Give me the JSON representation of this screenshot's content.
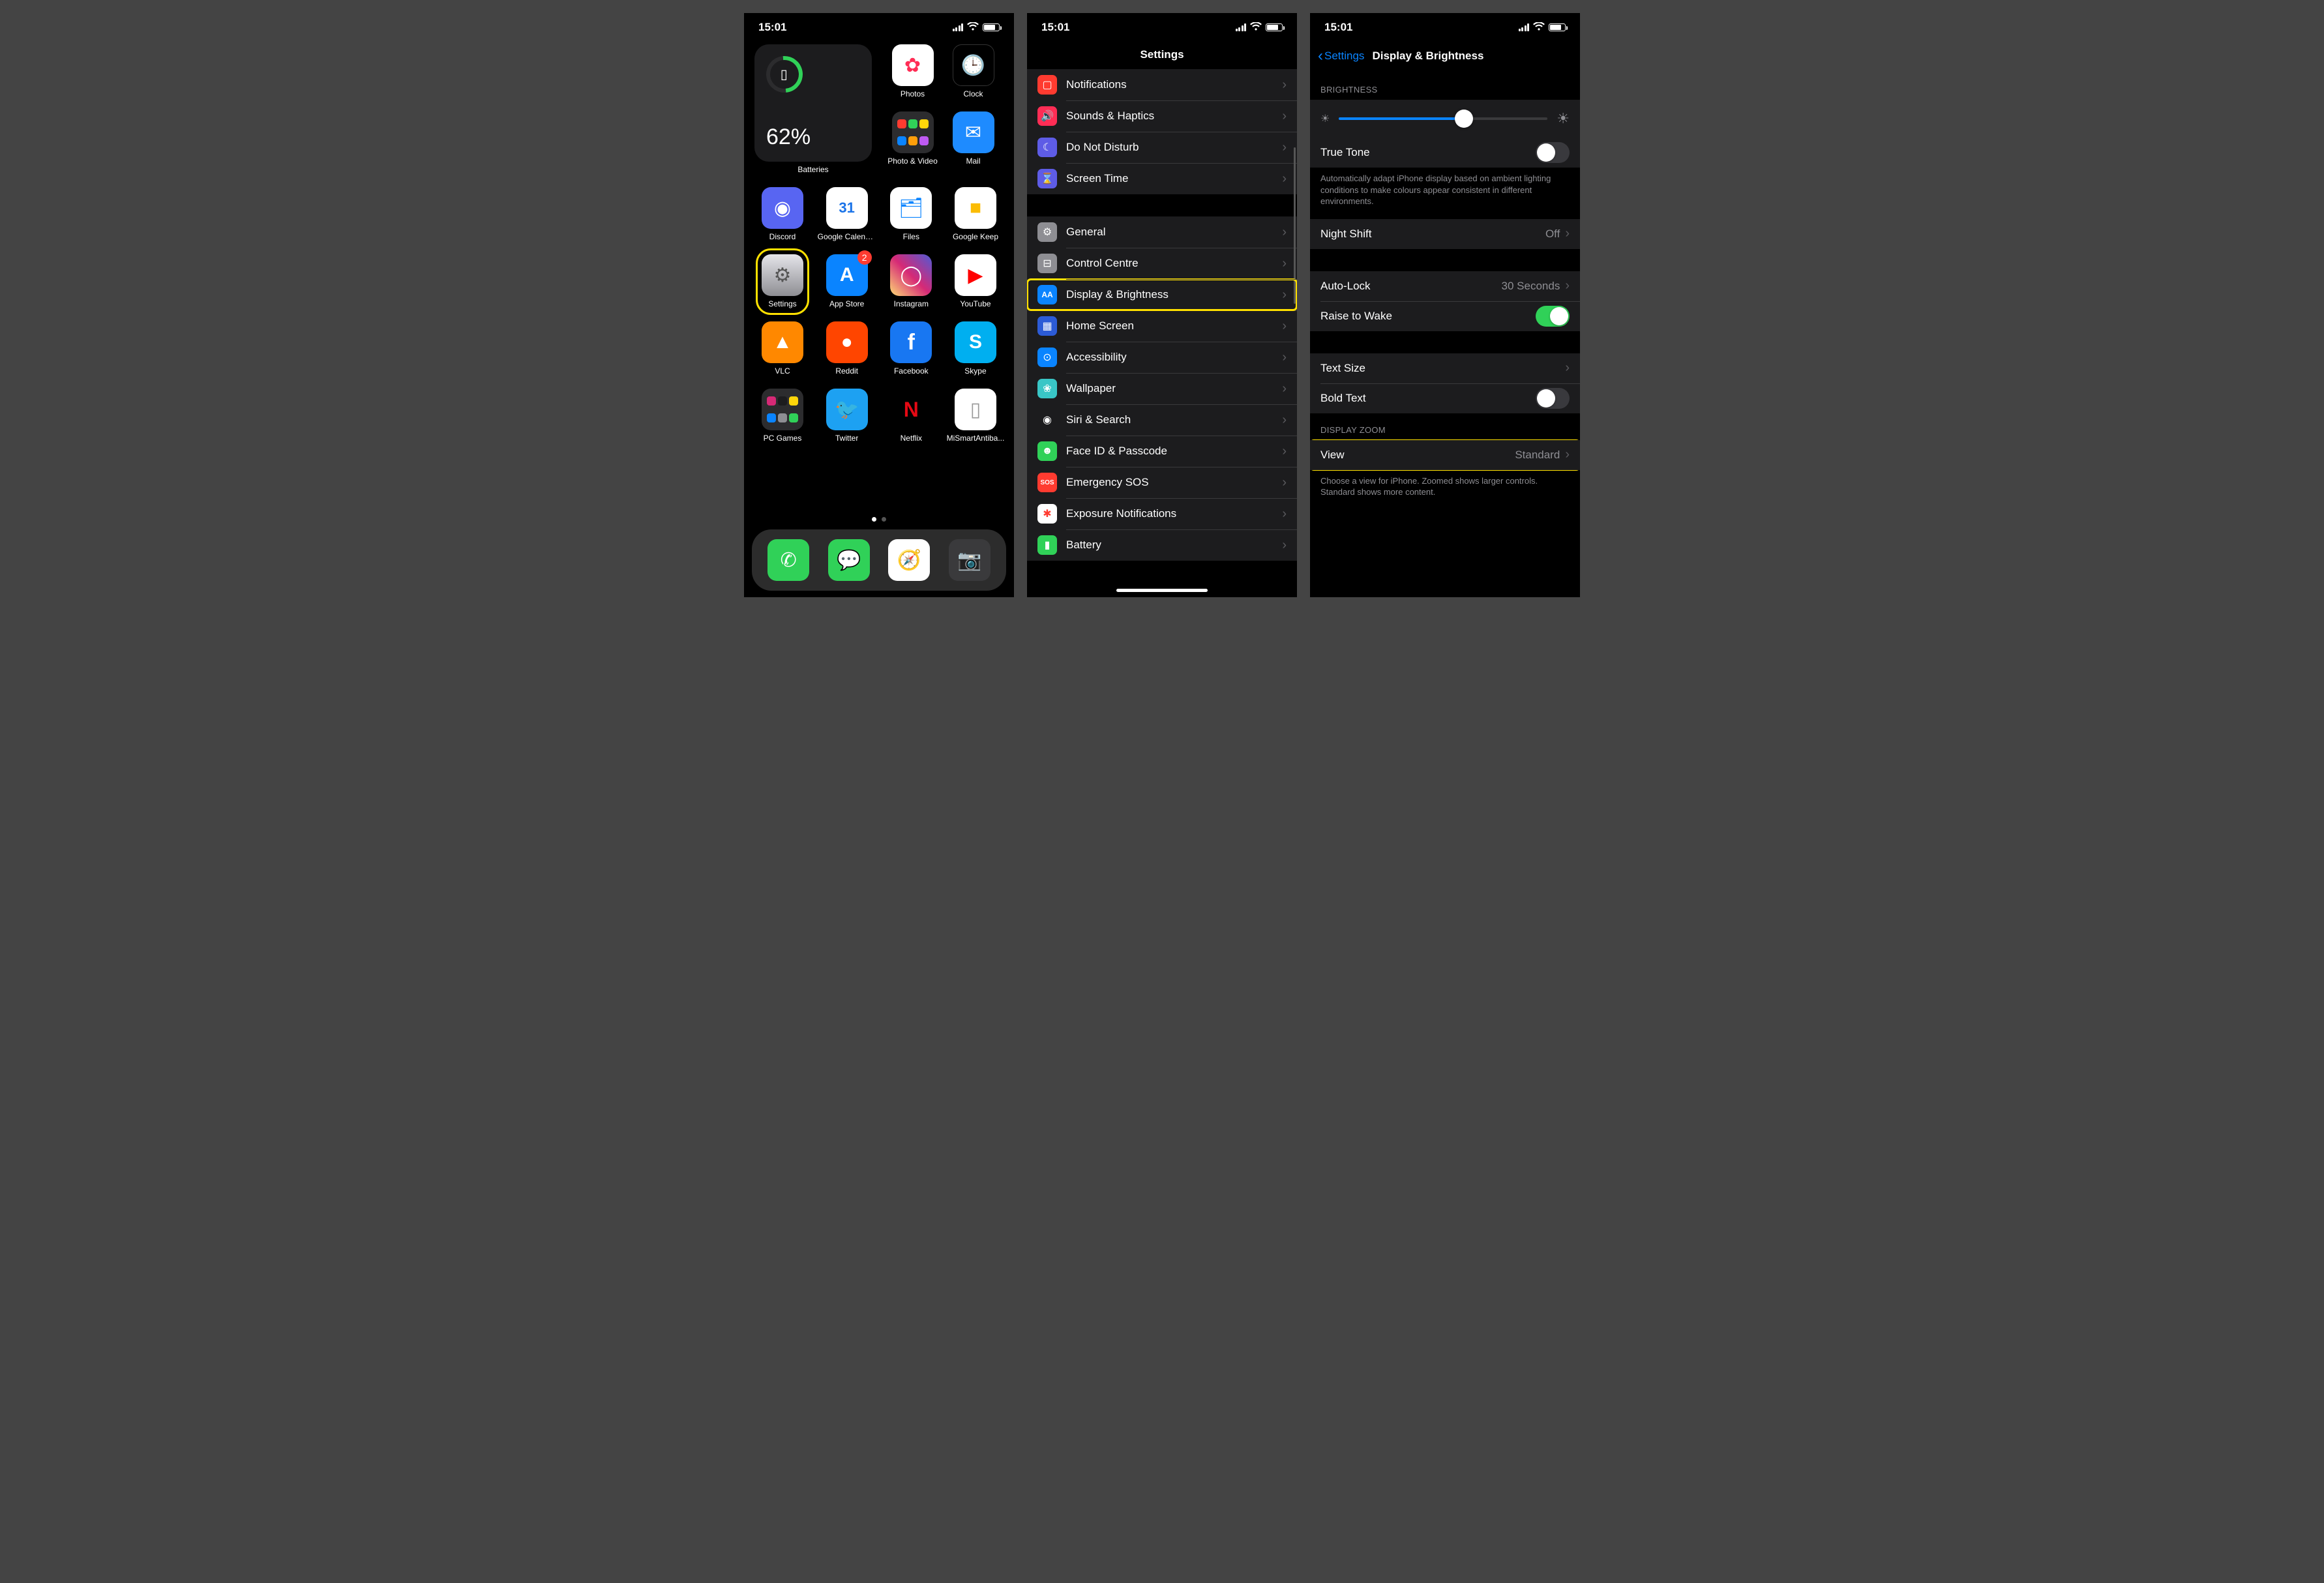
{
  "status": {
    "time": "15:01"
  },
  "home": {
    "widget": {
      "percent": "62%",
      "label": "Batteries"
    },
    "row1_right": [
      {
        "name": "Photos",
        "bg": "#fff",
        "glyph": "✿",
        "gcolor": "#ff2d55"
      },
      {
        "name": "Clock",
        "bg": "#000",
        "glyph": "🕒",
        "gcolor": "#fff",
        "border": "#333"
      }
    ],
    "row2_right": [
      {
        "name": "Photo & Video",
        "folder": true,
        "minis": [
          "#ff3b30",
          "#30d158",
          "#ffd60a",
          "#0a84ff",
          "#ff9f0a",
          "#bf5af2"
        ]
      },
      {
        "name": "Mail",
        "bg": "#1e8bff",
        "glyph": "✉",
        "gcolor": "#fff"
      }
    ],
    "row3": [
      {
        "name": "Discord",
        "bg": "#5865f2",
        "glyph": "◉",
        "gcolor": "#fff"
      },
      {
        "name": "Google Calendar",
        "bg": "#fff",
        "glyph": "31",
        "gcolor": "#1a73e8",
        "fs": "22px",
        "fw": "600"
      },
      {
        "name": "Files",
        "bg": "#fff",
        "glyph": "🗂",
        "gcolor": "#0a84ff"
      },
      {
        "name": "Google Keep",
        "bg": "#fff",
        "glyph": "■",
        "gcolor": "#fbbc04"
      }
    ],
    "row4": [
      {
        "name": "Settings",
        "bg": "linear-gradient(#e5e5ea,#8e8e93)",
        "glyph": "⚙",
        "gcolor": "#555",
        "highlight": true
      },
      {
        "name": "App Store",
        "bg": "#0a84ff",
        "glyph": "A",
        "gcolor": "#fff",
        "badge": "2",
        "fw": "700"
      },
      {
        "name": "Instagram",
        "bg": "linear-gradient(45deg,#feda75,#d62976,#4f5bd5)",
        "glyph": "◯",
        "gcolor": "#fff"
      },
      {
        "name": "YouTube",
        "bg": "#fff",
        "glyph": "▶",
        "gcolor": "#ff0000"
      }
    ],
    "row5": [
      {
        "name": "VLC",
        "bg": "#ff8800",
        "glyph": "▲",
        "gcolor": "#fff"
      },
      {
        "name": "Reddit",
        "bg": "#ff4500",
        "glyph": "●",
        "gcolor": "#fff"
      },
      {
        "name": "Facebook",
        "bg": "#1877f2",
        "glyph": "f",
        "gcolor": "#fff",
        "fw": "700",
        "fs": "34px"
      },
      {
        "name": "Skype",
        "bg": "#00aff0",
        "glyph": "S",
        "gcolor": "#fff",
        "fw": "700"
      }
    ],
    "row6": [
      {
        "name": "PC Games",
        "folder": true,
        "minis": [
          "#d62976",
          "#1c1c1e",
          "#ffd60a",
          "#0a84ff",
          "#8e8e93",
          "#30d158"
        ]
      },
      {
        "name": "Twitter",
        "bg": "#1da1f2",
        "glyph": "🐦",
        "gcolor": "#fff"
      },
      {
        "name": "Netflix",
        "bg": "#000",
        "glyph": "N",
        "gcolor": "#e50914",
        "fw": "800",
        "fs": "32px"
      },
      {
        "name": "MiSmartAntiba...",
        "bg": "#fff",
        "glyph": "▯",
        "gcolor": "#999"
      }
    ],
    "dock": [
      {
        "name": "Phone",
        "bg": "#30d158",
        "glyph": "✆",
        "gcolor": "#fff"
      },
      {
        "name": "Messages",
        "bg": "#30d158",
        "glyph": "💬",
        "gcolor": "#fff"
      },
      {
        "name": "Safari",
        "bg": "#fff",
        "glyph": "🧭",
        "gcolor": "#0a84ff"
      },
      {
        "name": "Camera",
        "bg": "#3a3a3c",
        "glyph": "📷",
        "gcolor": "#fff"
      }
    ]
  },
  "settings": {
    "title": "Settings",
    "group1": [
      {
        "label": "Notifications",
        "bg": "#ff3b30",
        "glyph": "▢"
      },
      {
        "label": "Sounds & Haptics",
        "bg": "#ff2d55",
        "glyph": "🔊"
      },
      {
        "label": "Do Not Disturb",
        "bg": "#5e5ce6",
        "glyph": "☾"
      },
      {
        "label": "Screen Time",
        "bg": "#5e5ce6",
        "glyph": "⌛"
      }
    ],
    "group2": [
      {
        "label": "General",
        "bg": "#8e8e93",
        "glyph": "⚙"
      },
      {
        "label": "Control Centre",
        "bg": "#8e8e93",
        "glyph": "⊟"
      },
      {
        "label": "Display & Brightness",
        "bg": "#0a84ff",
        "glyph": "AA",
        "fs": "12px",
        "fw": "700",
        "highlight": true
      },
      {
        "label": "Home Screen",
        "bg": "#2c5bd6",
        "glyph": "▦"
      },
      {
        "label": "Accessibility",
        "bg": "#0a84ff",
        "glyph": "⊙"
      },
      {
        "label": "Wallpaper",
        "bg": "#39c6c6",
        "glyph": "❀"
      },
      {
        "label": "Siri & Search",
        "bg": "#1c1c1e",
        "glyph": "◉"
      },
      {
        "label": "Face ID & Passcode",
        "bg": "#30d158",
        "glyph": "☻"
      },
      {
        "label": "Emergency SOS",
        "bg": "#ff3b30",
        "glyph": "SOS",
        "fs": "10px",
        "fw": "800"
      },
      {
        "label": "Exposure Notifications",
        "bg": "#fff",
        "glyph": "✱",
        "gcolor": "#ff3b30"
      },
      {
        "label": "Battery",
        "bg": "#30d158",
        "glyph": "▮"
      }
    ]
  },
  "display": {
    "back": "Settings",
    "title": "Display & Brightness",
    "sec_brightness": "BRIGHTNESS",
    "true_tone": {
      "label": "True Tone",
      "on": false
    },
    "true_tone_desc": "Automatically adapt iPhone display based on ambient lighting conditions to make colours appear consistent in different environments.",
    "night_shift": {
      "label": "Night Shift",
      "value": "Off"
    },
    "auto_lock": {
      "label": "Auto-Lock",
      "value": "30 Seconds"
    },
    "raise": {
      "label": "Raise to Wake",
      "on": true
    },
    "text_size": {
      "label": "Text Size"
    },
    "bold": {
      "label": "Bold Text",
      "on": false
    },
    "sec_zoom": "DISPLAY ZOOM",
    "view": {
      "label": "View",
      "value": "Standard"
    },
    "view_desc": "Choose a view for iPhone. Zoomed shows larger controls. Standard shows more content."
  }
}
